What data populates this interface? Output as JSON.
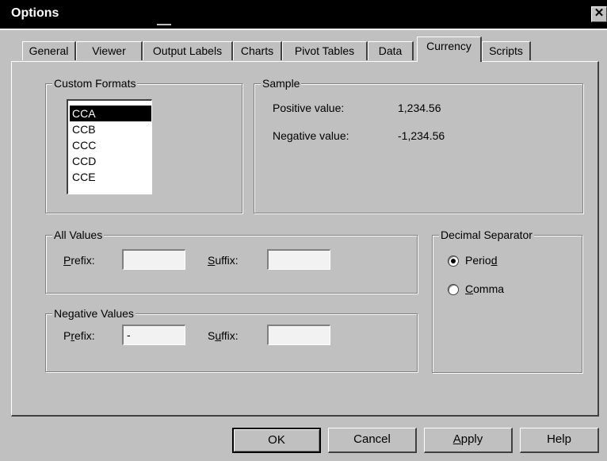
{
  "window": {
    "title": "Options"
  },
  "tabs": [
    {
      "label": "General"
    },
    {
      "label": "Viewer"
    },
    {
      "label": "Output Labels"
    },
    {
      "label": "Charts"
    },
    {
      "label": "Pivot Tables"
    },
    {
      "label": "Data"
    },
    {
      "label": "Currency",
      "active": true
    },
    {
      "label": "Scripts"
    }
  ],
  "custom_formats": {
    "label": "Custom Formats",
    "items": [
      "CCA",
      "CCB",
      "CCC",
      "CCD",
      "CCE"
    ],
    "selected": "CCA"
  },
  "sample": {
    "label": "Sample",
    "positive_label": "Positive value:",
    "positive_value": "1,234.56",
    "negative_label": "Negative value:",
    "negative_value": "-1,234.56"
  },
  "all_values": {
    "label": "All Values",
    "prefix_label": "Prefix:",
    "prefix_value": "",
    "suffix_label": "Suffix:",
    "suffix_value": ""
  },
  "negative_values": {
    "label": "Negative Values",
    "prefix_label": "Prefix:",
    "prefix_value": "-",
    "suffix_label": "Suffix:",
    "suffix_value": ""
  },
  "decimal_separator": {
    "label": "Decimal Separator",
    "options": [
      "Period",
      "Comma"
    ],
    "selected": "Period"
  },
  "buttons": {
    "ok": "OK",
    "cancel": "Cancel",
    "apply": "Apply",
    "help": "Help"
  },
  "icons": {
    "close": "close-icon"
  }
}
